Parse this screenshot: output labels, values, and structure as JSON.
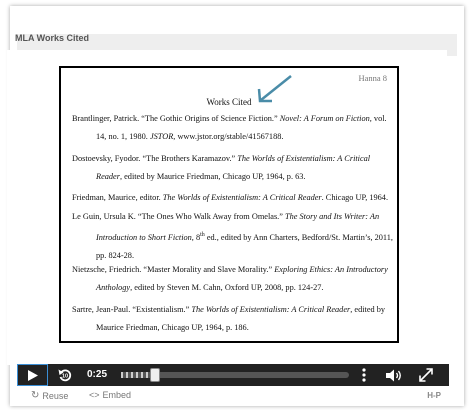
{
  "header": {
    "title": "MLA Works Cited"
  },
  "document": {
    "page_number": "Hanna 8",
    "title": "Works Cited",
    "entries": [
      {
        "l1_a": "Brantlinger, Patrick. “The Gothic Origins of Science Fiction.” ",
        "l1_i": "Novel: A Forum on Fiction",
        "l1_b": ", vol.",
        "l2_a": "14, no. 1, 1980. ",
        "l2_i": "JSTOR",
        "l2_b": ", www.jstor.org/stable/41567188."
      },
      {
        "l1_a": "Dostoevsky, Fyodor. “The Brothers Karamazov.” ",
        "l1_i": "The Worlds of Existentialism: A Critical",
        "l2_i": "Reader",
        "l2_b": ", edited by Maurice Friedman, Chicago UP, 1964, p. 63."
      },
      {
        "l1_a": "Friedman, Maurice, editor. ",
        "l1_i": "The Worlds of Existentialism: A Critical Reader",
        "l1_b": ". Chicago UP, 1964."
      },
      {
        "l1_a": "Le Guin, Ursula K. “The Ones Who Walk Away from Omelas.” ",
        "l1_i": "The Story and Its Writer: An",
        "l2_i": "Introduction to Short Fiction",
        "l2_b": ", 8",
        "l2_sup": "th",
        "l2_c": " ed., edited by Ann Charters, Bedford/St. Martin’s, 2011,",
        "l3": "pp. 824-28."
      },
      {
        "l1_a": "Nietzsche, Friedrich.  “Master Morality and Slave Morality.” ",
        "l1_i": "Exploring Ethics: An Introductory",
        "l2_i": "Anthology",
        "l2_b": ", edited by Steven M. Cahn, Oxford UP, 2008, pp. 124-27."
      },
      {
        "l1_a": "Sartre, Jean-Paul. “Existentialism.” ",
        "l1_i": "The Worlds of Existentialism: A Critical Reader",
        "l1_b": ", edited by",
        "l2_a": "Maurice Friedman, Chicago UP, 1964, p. 186."
      }
    ]
  },
  "player": {
    "time": "0:25",
    "progress": 0.15,
    "icons": [
      "play-icon",
      "rewind-icon",
      "more-options-icon",
      "volume-icon",
      "fullscreen-icon"
    ],
    "accent": "#3b8fd6"
  },
  "footer": {
    "reuse": "Reuse",
    "embed": "Embed",
    "brand": "H-P"
  }
}
